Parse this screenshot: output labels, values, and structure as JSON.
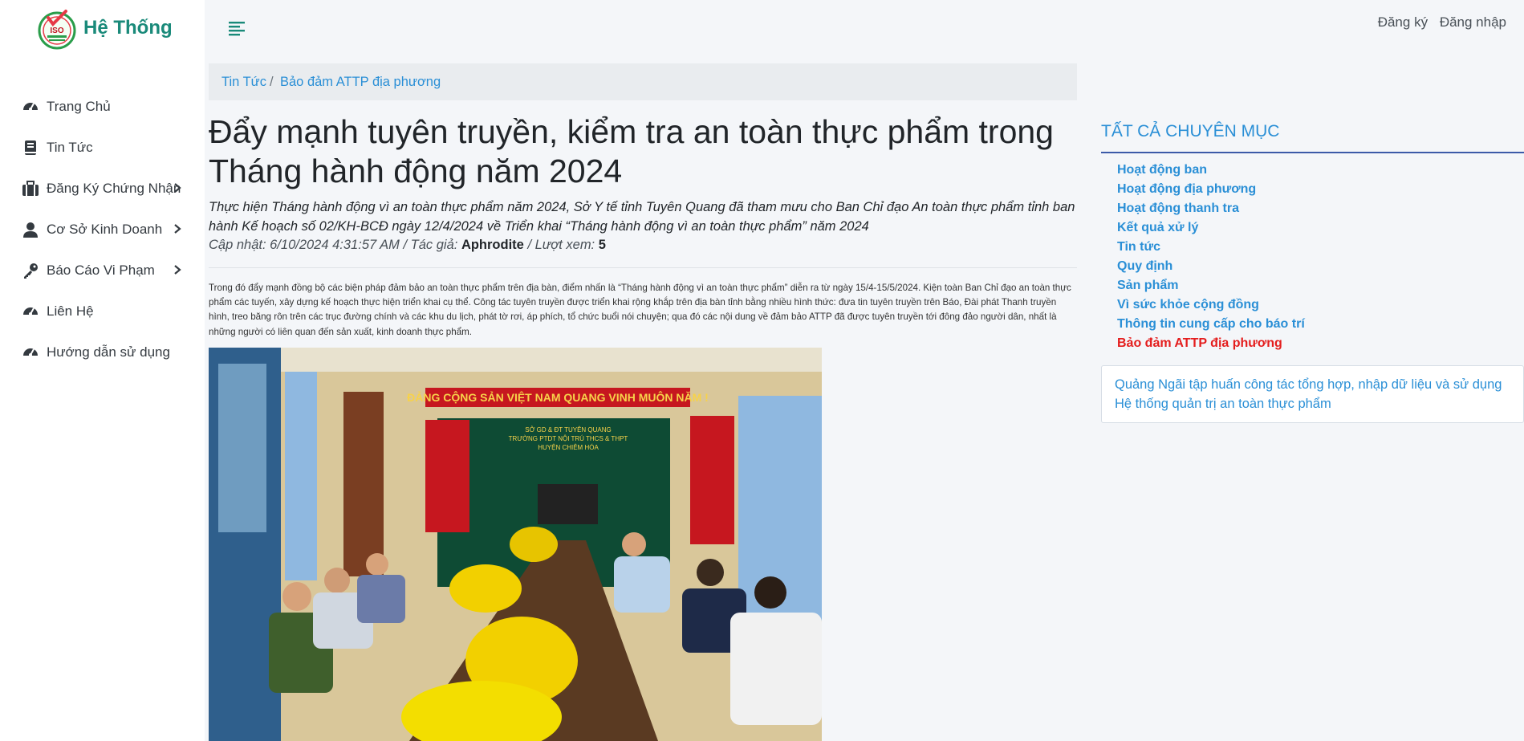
{
  "brand": {
    "name": "Hệ Thống",
    "logo_label": "ISO"
  },
  "nav": {
    "items": [
      {
        "label": "Trang Chủ",
        "icon": "dashboard-icon",
        "has_chevron": false
      },
      {
        "label": "Tin Tức",
        "icon": "book-icon",
        "has_chevron": false
      },
      {
        "label": "Đăng Ký Chứng Nhận",
        "icon": "briefcase-icon",
        "has_chevron": true
      },
      {
        "label": "Cơ Sở Kinh Doanh",
        "icon": "user-icon",
        "has_chevron": true
      },
      {
        "label": "Báo Cáo Vi Phạm",
        "icon": "key-icon",
        "has_chevron": true
      },
      {
        "label": "Liên Hệ",
        "icon": "dashboard-icon",
        "has_chevron": false
      },
      {
        "label": "Hướng dẫn sử dụng",
        "icon": "dashboard-icon",
        "has_chevron": false
      }
    ]
  },
  "topbar": {
    "register": "Đăng ký",
    "login": "Đăng nhập"
  },
  "breadcrumb": {
    "first": "Tin Tức",
    "separator": "/",
    "second": "Bảo đảm ATTP địa phương"
  },
  "article": {
    "title": "Đẩy mạnh tuyên truyền, kiểm tra an toàn thực phẩm trong Tháng hành động năm 2024",
    "summary": "Thực hiện Tháng hành động vì an toàn thực phẩm năm 2024, Sở Y tế tỉnh Tuyên Quang đã tham mưu cho Ban Chỉ đạo An toàn thực phẩm tỉnh ban hành Kế hoạch số 02/KH-BCĐ ngày 12/4/2024 về Triển khai “Tháng hành động vì an toàn thực phẩm” năm 2024",
    "meta": {
      "updated_label": "Cập nhật: 6/10/2024 4:31:57 AM / Tác giả: ",
      "author": "Aphrodite",
      "views_label": " / Lượt xem: ",
      "views": "5"
    },
    "body": "Trong đó đẩy mạnh đồng bộ các biện pháp đảm bảo an toàn thực phẩm trên địa bàn, điểm nhấn là “Tháng hành động vì an toàn thực phẩm” diễn ra từ ngày 15/4-15/5/2024. Kiện toàn Ban Chỉ đạo an toàn thực phẩm các tuyến, xây dựng kế hoạch thực hiện triển khai cụ thể. Công tác tuyên truyền được triển khai rộng khắp trên địa bàn tỉnh bằng nhiều hình thức: đưa tin tuyên truyền trên Báo, Đài phát Thanh truyền hình, treo băng rôn trên các trục đường chính và các khu du lịch, phát tờ rơi, áp phích, tổ chức buổi nói chuyện; qua đó các nội dung về đảm bảo ATTP đã được tuyên truyền tới đông đảo người dân, nhất là những người có liên quan đến sản xuất, kinh doanh thực phẩm.",
    "photo": {
      "banner": "ĐẢNG CỘNG SẢN VIỆT NAM QUANG VINH MUÔN NĂM !",
      "board": "SỞ GD & ĐT TUYÊN QUANG\nTRƯỜNG PTDT NỘI TRÚ THCS & THPT\nHUYỆN CHIÊM HÓA"
    }
  },
  "categories": {
    "title": "TẤT CẢ CHUYÊN MỤC",
    "items": [
      {
        "label": "Hoạt động ban",
        "active": false
      },
      {
        "label": "Hoạt động địa phương",
        "active": false
      },
      {
        "label": "Hoạt động thanh tra",
        "active": false
      },
      {
        "label": "Kết quả xử lý",
        "active": false
      },
      {
        "label": "Tin tức",
        "active": false
      },
      {
        "label": "Quy định",
        "active": false
      },
      {
        "label": "Sản phẩm",
        "active": false
      },
      {
        "label": "Vì sức khỏe cộng đồng",
        "active": false
      },
      {
        "label": "Thông tin cung cấp cho báo trí",
        "active": false
      },
      {
        "label": "Bảo đảm ATTP địa phương",
        "active": true
      }
    ]
  },
  "related": {
    "link": "Quảng Ngãi tập huấn công tác tổng hợp, nhập dữ liệu và sử dụng Hệ thống quản trị an toàn thực phẩm"
  },
  "colors": {
    "brand": "#1a8a7a",
    "link": "#2a8fd6",
    "active": "#e41d1d",
    "rule": "#3b5aa8"
  }
}
